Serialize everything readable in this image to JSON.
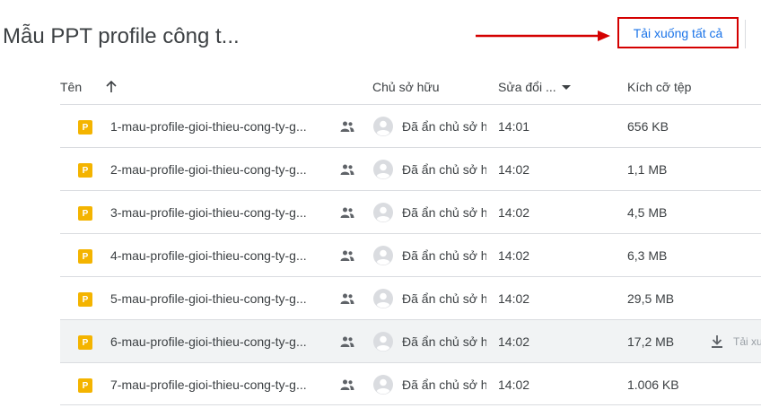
{
  "page": {
    "title": "Mẫu PPT profile công t..."
  },
  "toolbar": {
    "download_all_label": "Tải xuống tất cả"
  },
  "columns": {
    "name": "Tên",
    "owner": "Chủ sở hữu",
    "modified": "Sửa đổi ...",
    "size": "Kích cỡ tệp"
  },
  "files": [
    {
      "name": "1-mau-profile-gioi-thieu-cong-ty-g...",
      "icon_letter": "P",
      "owner": "Đã ẩn chủ sở hữu",
      "modified": "14:01",
      "size": "656 KB"
    },
    {
      "name": "2-mau-profile-gioi-thieu-cong-ty-g...",
      "icon_letter": "P",
      "owner": "Đã ẩn chủ sở hữu",
      "modified": "14:02",
      "size": "1,1 MB"
    },
    {
      "name": "3-mau-profile-gioi-thieu-cong-ty-g...",
      "icon_letter": "P",
      "owner": "Đã ẩn chủ sở hữu",
      "modified": "14:02",
      "size": "4,5 MB"
    },
    {
      "name": "4-mau-profile-gioi-thieu-cong-ty-g...",
      "icon_letter": "P",
      "owner": "Đã ẩn chủ sở hữu",
      "modified": "14:02",
      "size": "6,3 MB"
    },
    {
      "name": "5-mau-profile-gioi-thieu-cong-ty-g...",
      "icon_letter": "P",
      "owner": "Đã ẩn chủ sở hữu",
      "modified": "14:02",
      "size": "29,5 MB"
    },
    {
      "name": "6-mau-profile-gioi-thieu-cong-ty-g...",
      "icon_letter": "P",
      "owner": "Đã ẩn chủ sở hữu",
      "modified": "14:02",
      "size": "17,2 MB",
      "download_label": "Tải xuống"
    },
    {
      "name": "7-mau-profile-gioi-thieu-cong-ty-g...",
      "icon_letter": "P",
      "owner": "Đã ẩn chủ sở hữu",
      "modified": "14:02",
      "size": "1.006 KB"
    }
  ],
  "icons": {
    "file": "slides-file-icon",
    "shared": "people-icon",
    "owner": "account-circle-icon",
    "download": "download-icon",
    "sort": "arrow-up-icon",
    "arrow": "red-arrow-icon"
  },
  "colors": {
    "accent": "#1a73e8",
    "highlight_border": "#d40000",
    "file_icon": "#f4b400",
    "row_hover": "#f1f3f4",
    "divider": "#dadce0"
  }
}
